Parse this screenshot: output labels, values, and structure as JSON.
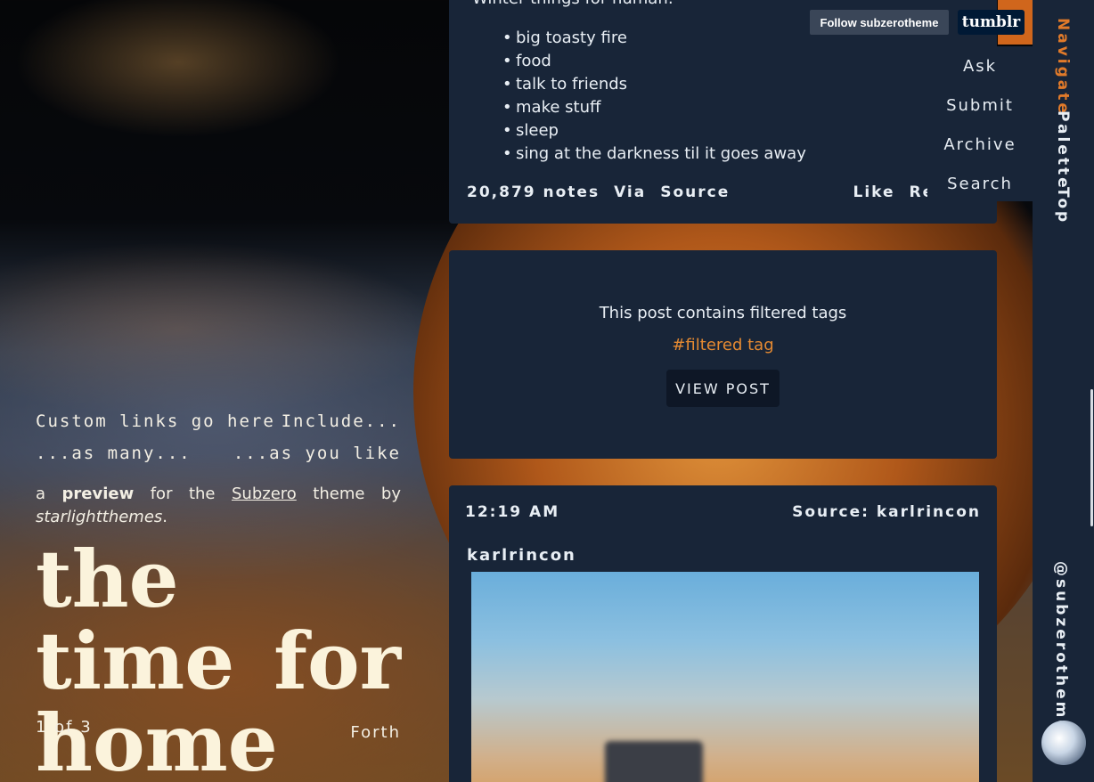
{
  "sidebar": {
    "links_row1": [
      "Custom links go here",
      "Include..."
    ],
    "links_row2": [
      "...as many...",
      "...as you like"
    ],
    "desc_a": "a ",
    "desc_preview": "preview",
    "desc_for": " for the ",
    "desc_theme": "Subzero",
    "desc_by": " theme by ",
    "desc_author": "starlightthemes",
    "desc_end": ".",
    "title": "the time for home",
    "pager_count": "1 of 3",
    "pager_next": "Forth"
  },
  "post1": {
    "lead": "Winter things for human:",
    "items": [
      "big toasty fire",
      "food",
      "talk to friends",
      "make stuff",
      "sleep",
      "sing at the darkness til it goes away"
    ],
    "notes": "20,879 notes",
    "via": "Via",
    "source": "Source",
    "like": "Like",
    "reblog": "Reblog"
  },
  "post2": {
    "message": "This post contains filtered tags",
    "tag": "#filtered tag",
    "view_button": "VIEW POST"
  },
  "post3": {
    "time": "12:19 AM",
    "source": "Source: karlrincon",
    "user": "karlrincon"
  },
  "tumblr_bar": {
    "follow": "Follow subzerotheme",
    "logo": "tumblr"
  },
  "navmenu": [
    "Ask",
    "Submit",
    "Archive",
    "Search"
  ],
  "rail": {
    "navigate": "Navigate",
    "palette": "Palette",
    "top": "Top",
    "handle": "@subzerotheme"
  },
  "colors": {
    "accent": "#e07a2a",
    "panel": "#182538",
    "tag": "#e58a32"
  }
}
